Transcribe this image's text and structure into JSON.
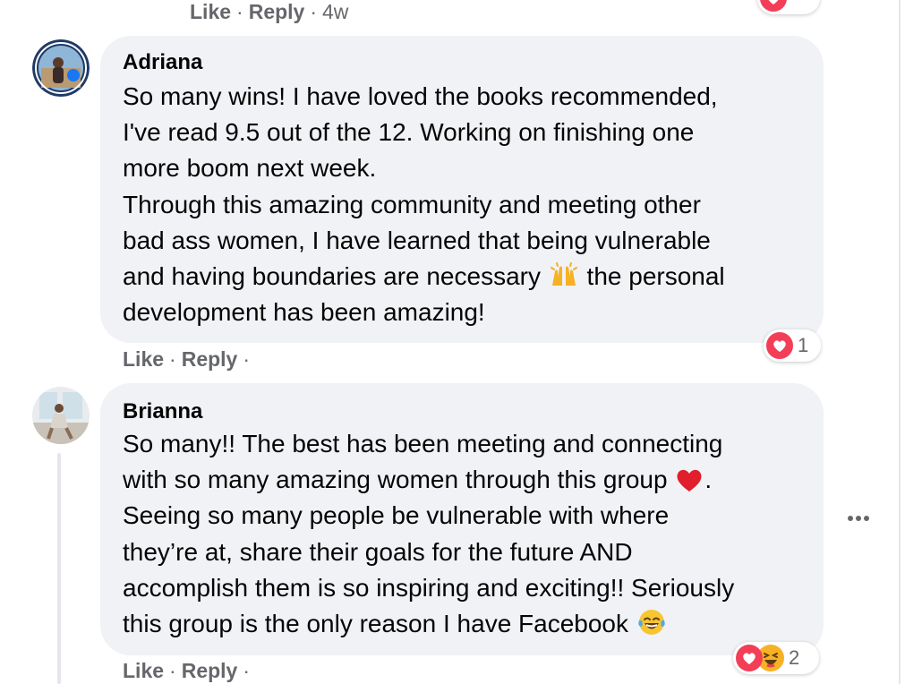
{
  "top_actions": {
    "like": "Like",
    "reply": "Reply",
    "separator": "·",
    "time": "4w"
  },
  "comments": [
    {
      "author": "Adriana",
      "lines": [
        "So many wins! I have loved the books recommended,",
        "I've read 9.5 out of the 12. Working on finishing one",
        "more boom next week.",
        "Through this amazing community and meeting other",
        "bad ass women, I have learned that being vulnerable",
        "and having boundaries are necessary",
        "the personal",
        "development has been amazing!"
      ],
      "emoji": [
        "raising-hands"
      ],
      "actions": {
        "like": "Like",
        "reply": "Reply",
        "separator": "·"
      },
      "reactions": {
        "icons": [
          "love-reaction"
        ],
        "count": "1"
      }
    },
    {
      "author": "Brianna",
      "lines": [
        "So many!! The best has been meeting and connecting",
        "with so many amazing women through this group",
        ".",
        "Seeing so many people be vulnerable with where",
        "they’re at, share their goals for the future AND",
        "accomplish them is so inspiring and exciting!! Seriously",
        "this group is the only reason I have Facebook"
      ],
      "emoji": [
        "red-heart",
        "tears-of-joy"
      ],
      "actions": {
        "like": "Like",
        "reply": "Reply",
        "separator": "·"
      },
      "reactions": {
        "icons": [
          "love-reaction",
          "haha-reaction"
        ],
        "count": "2"
      }
    }
  ],
  "colors": {
    "bubble": "#f0f2f5",
    "meta_text": "#65676b",
    "love": "#f33e58",
    "haha": "#f7b125"
  }
}
